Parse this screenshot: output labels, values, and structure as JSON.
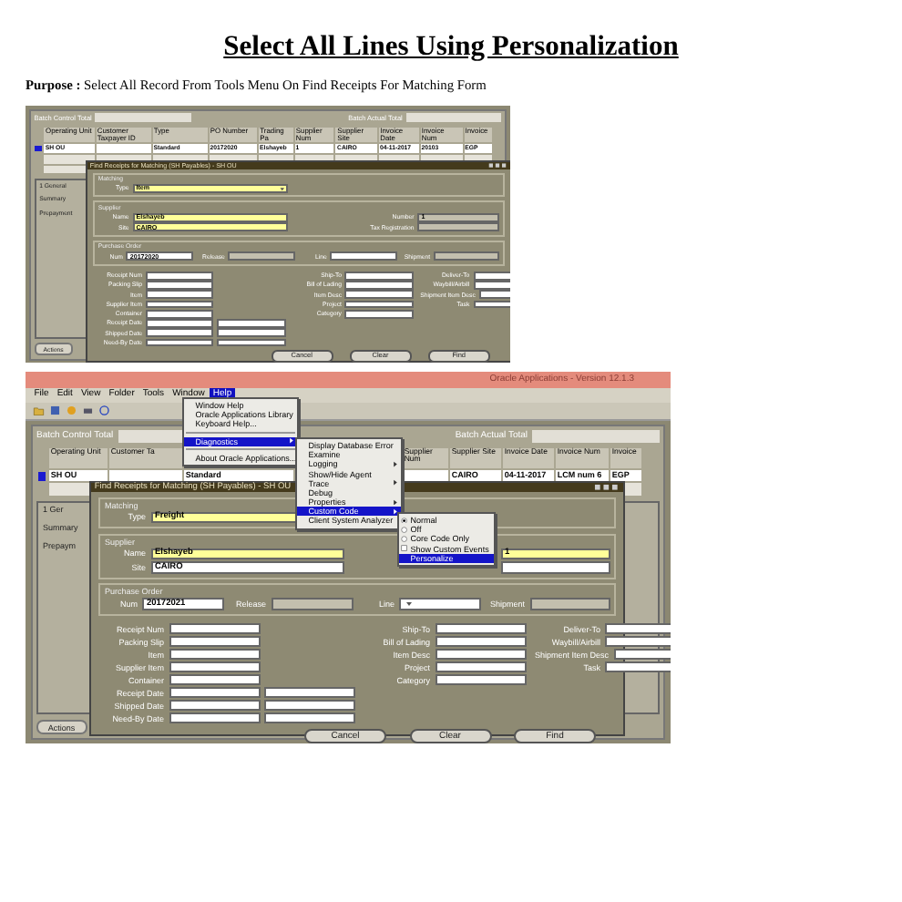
{
  "heading": "Select All Lines Using Personalization",
  "purpose": {
    "label": "Purpose :",
    "text": "Select All Record From Tools Menu On Find Receipts For Matching Form"
  },
  "screenshots": [
    {
      "batch_labels": [
        "Batch Control Total",
        "Batch Actual Total"
      ],
      "grid": {
        "columns": [
          "Operating Unit",
          "Customer Taxpayer ID",
          "Type",
          "PO Number",
          "Trading Pa",
          "Supplier Num",
          "Supplier Site",
          "Invoice Date",
          "Invoice Num",
          "Invoice"
        ],
        "rows": [
          [
            "SH OU",
            null,
            "Standard",
            "20172020",
            "Elshayeb",
            "1",
            "CAIRO",
            "04-11-2017",
            "20103",
            "EGP"
          ]
        ]
      },
      "tab_label": "1 General",
      "panel_labels": [
        "Summary",
        "Prepayment"
      ],
      "action_button": "Actions",
      "dialog": {
        "title": "Find Receipts for Matching (SH Payables) - SH OU",
        "groups": [
          {
            "title": "Matching",
            "kind": "pair",
            "fields": [
              {
                "label": "Type",
                "value": "Item",
                "required": true,
                "disabled": false,
                "kind": "dropdown"
              }
            ]
          },
          {
            "title": "Supplier",
            "kind": "pair",
            "fields": [
              {
                "label": "Name",
                "value": "Elshayeb",
                "required": true,
                "disabled": false,
                "kind": "text"
              },
              {
                "label": "Number",
                "value": "1",
                "required": false,
                "disabled": true,
                "kind": "text"
              },
              {
                "label": "Site",
                "value": "CAIRO",
                "required": true,
                "disabled": false,
                "kind": "text"
              },
              {
                "label": "Tax Registration",
                "required": false,
                "disabled": true,
                "kind": "text"
              }
            ]
          },
          {
            "title": "Purchase Order",
            "kind": "row",
            "fields": [
              {
                "label": "Num",
                "value": "20172020",
                "required": false,
                "disabled": false,
                "kind": "text"
              },
              {
                "label": "Release",
                "required": false,
                "disabled": true,
                "kind": "text"
              },
              {
                "label": "Line",
                "required": false,
                "disabled": false,
                "kind": "text"
              },
              {
                "label": "Shipment",
                "required": false,
                "disabled": true,
                "kind": "text"
              }
            ]
          }
        ],
        "criteria": [
          [
            {
              "label": "Receipt Num",
              "range": false
            },
            {
              "label": "Packing Slip",
              "range": false
            },
            {
              "label": "Item",
              "range": false
            },
            {
              "label": "Supplier Item",
              "range": false
            },
            {
              "label": "Container",
              "range": false
            },
            {
              "label": "Receipt Date",
              "range": true
            },
            {
              "label": "Shipped Date",
              "range": true
            },
            {
              "label": "Need-By Date",
              "range": true
            }
          ],
          [
            {
              "label": "Ship-To",
              "range": false
            },
            {
              "label": "Bill of Lading",
              "range": false
            },
            {
              "label": "Item Desc",
              "range": false
            },
            {
              "label": "Project",
              "range": false
            },
            {
              "label": "Category",
              "range": false
            }
          ],
          [
            {
              "label": "Deliver-To",
              "range": false
            },
            {
              "label": "Waybill/Airbill",
              "range": false
            },
            {
              "label": "Shipment Item Desc",
              "range": false
            },
            {
              "label": "Task",
              "range": false
            }
          ]
        ],
        "buttons": [
          "Cancel",
          "Clear",
          "Find"
        ]
      }
    },
    {
      "title_bar": "Oracle Applications - Version 12.1.3",
      "menu_bar": [
        {
          "label": "File",
          "selected": false
        },
        {
          "label": "Edit",
          "selected": false
        },
        {
          "label": "View",
          "selected": false
        },
        {
          "label": "Folder",
          "selected": false
        },
        {
          "label": "Tools",
          "selected": false
        },
        {
          "label": "Window",
          "selected": false
        },
        {
          "label": "Help",
          "selected": true
        }
      ],
      "menus": [
        [
          {
            "kind": "plain",
            "label": "Window Help",
            "selected": false,
            "submenu": false
          },
          {
            "kind": "plain",
            "label": "Oracle Applications Library",
            "selected": false,
            "submenu": false
          },
          {
            "kind": "plain",
            "label": "Keyboard Help...",
            "selected": false,
            "submenu": false
          },
          {
            "kind": "separator"
          },
          {
            "kind": "plain",
            "label": "Diagnostics",
            "selected": true,
            "submenu": true
          },
          {
            "kind": "separator"
          },
          {
            "kind": "plain",
            "label": "About Oracle Applications...",
            "selected": false,
            "submenu": false
          }
        ],
        [
          {
            "kind": "plain",
            "label": "Display Database Error",
            "selected": false,
            "submenu": false
          },
          {
            "kind": "plain",
            "label": "Examine",
            "selected": false,
            "submenu": false
          },
          {
            "kind": "plain",
            "label": "Logging",
            "selected": false,
            "submenu": true
          },
          {
            "kind": "plain",
            "label": "Show/Hide Agent",
            "selected": false,
            "submenu": false
          },
          {
            "kind": "plain",
            "label": "Trace",
            "selected": false,
            "submenu": true
          },
          {
            "kind": "plain",
            "label": "Debug",
            "selected": false,
            "submenu": false
          },
          {
            "kind": "plain",
            "label": "Properties",
            "selected": false,
            "submenu": true
          },
          {
            "kind": "plain",
            "label": "Custom Code",
            "selected": true,
            "submenu": true
          },
          {
            "kind": "plain",
            "label": "Client System Analyzer",
            "selected": false,
            "submenu": false
          }
        ],
        [
          {
            "kind": "radio",
            "label": "Normal",
            "checked": true,
            "selected": false,
            "submenu": false
          },
          {
            "kind": "radio",
            "label": "Off",
            "checked": false,
            "selected": false,
            "submenu": false
          },
          {
            "kind": "radio",
            "label": "Core Code Only",
            "checked": false,
            "selected": false,
            "submenu": false
          },
          {
            "kind": "check",
            "label": "Show Custom Events",
            "checked": false,
            "selected": false,
            "submenu": false
          },
          {
            "kind": "plain",
            "label": "Personalize",
            "selected": true,
            "submenu": false
          }
        ]
      ],
      "batch_labels": [
        "Batch Control Total",
        "Batch Actual Total"
      ],
      "grid": {
        "columns": [
          "Operating Unit",
          "Customer Ta",
          null,
          null,
          "Supplier Num",
          "Supplier Site",
          "Invoice Date",
          "Invoice Num",
          "Invoice"
        ],
        "rows": [
          [
            "SH OU",
            null,
            "Standard",
            null,
            null,
            "CAIRO",
            "04-11-2017",
            "LCM num 6",
            "EGP"
          ]
        ]
      },
      "tab_label": "1 Ger",
      "panel_labels": [
        "Summary",
        "Prepaym"
      ],
      "action_button": "Actions",
      "dialog": {
        "title": "Find Receipts for Matching (SH Payables) - SH OU",
        "groups": [
          {
            "title": "Matching",
            "kind": "pair",
            "fields": [
              {
                "label": "Type",
                "value": "Freight",
                "required": true,
                "disabled": false,
                "kind": "dropdown"
              }
            ]
          },
          {
            "title": "Supplier",
            "kind": "pair",
            "fields": [
              {
                "label": "Name",
                "value": "Elshayeb",
                "required": true,
                "disabled": false,
                "kind": "text"
              },
              {
                "value": "1",
                "required": true,
                "disabled": false,
                "kind": "text"
              },
              {
                "label": "Site",
                "value": "CAIRO",
                "required": false,
                "disabled": false,
                "kind": "text"
              },
              {
                "required": false,
                "disabled": false,
                "kind": "text"
              }
            ]
          },
          {
            "title": "Purchase Order",
            "kind": "row",
            "fields": [
              {
                "label": "Num",
                "value": "20172021",
                "required": false,
                "disabled": false,
                "kind": "text"
              },
              {
                "label": "Release",
                "required": false,
                "disabled": true,
                "kind": "text"
              },
              {
                "label": "Line",
                "required": false,
                "disabled": false,
                "kind": "dropdown"
              },
              {
                "label": "Shipment",
                "required": false,
                "disabled": true,
                "kind": "text"
              }
            ]
          }
        ],
        "criteria": [
          [
            {
              "label": "Receipt Num",
              "range": false
            },
            {
              "label": "Packing Slip",
              "range": false
            },
            {
              "label": "Item",
              "range": false
            },
            {
              "label": "Supplier Item",
              "range": false
            },
            {
              "label": "Container",
              "range": false
            },
            {
              "label": "Receipt Date",
              "range": true
            },
            {
              "label": "Shipped Date",
              "range": true
            },
            {
              "label": "Need-By Date",
              "range": true
            }
          ],
          [
            {
              "label": "Ship-To",
              "range": false
            },
            {
              "label": "Bill of Lading",
              "range": false
            },
            {
              "label": "Item Desc",
              "range": false
            },
            {
              "label": "Project",
              "range": false
            },
            {
              "label": "Category",
              "range": false
            }
          ],
          [
            {
              "label": "Deliver-To",
              "range": false
            },
            {
              "label": "Waybill/Airbill",
              "range": false
            },
            {
              "label": "Shipment Item Desc",
              "range": false
            },
            {
              "label": "Task",
              "range": false
            }
          ]
        ],
        "buttons": [
          "Cancel",
          "Clear",
          "Find"
        ]
      }
    }
  ]
}
